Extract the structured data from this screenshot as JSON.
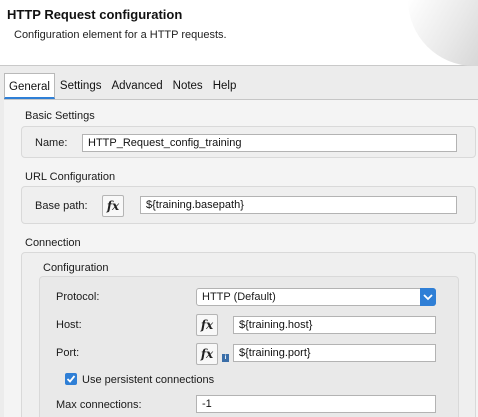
{
  "header": {
    "title": "HTTP Request configuration",
    "subtitle": "Configuration element for a HTTP requests."
  },
  "tabs": [
    {
      "label": "General",
      "active": true
    },
    {
      "label": "Settings",
      "active": false
    },
    {
      "label": "Advanced",
      "active": false
    },
    {
      "label": "Notes",
      "active": false
    },
    {
      "label": "Help",
      "active": false
    }
  ],
  "basic_settings": {
    "title": "Basic Settings",
    "name_label": "Name:",
    "name_value": "HTTP_Request_config_training"
  },
  "url_configuration": {
    "title": "URL Configuration",
    "base_path_label": "Base path:",
    "base_path_value": "${training.basepath}",
    "fx_label": "fx"
  },
  "connection": {
    "title": "Connection",
    "configuration_title": "Configuration",
    "protocol_label": "Protocol:",
    "protocol_value": "HTTP (Default)",
    "host_label": "Host:",
    "host_value": "${training.host}",
    "port_label": "Port:",
    "port_value": "${training.port}",
    "info_badge": "i",
    "persistent_label": "Use persistent connections",
    "persistent_checked": true,
    "max_connections_label": "Max connections:",
    "max_connections_value": "-1"
  },
  "colors": {
    "accent": "#2f7fd6"
  }
}
